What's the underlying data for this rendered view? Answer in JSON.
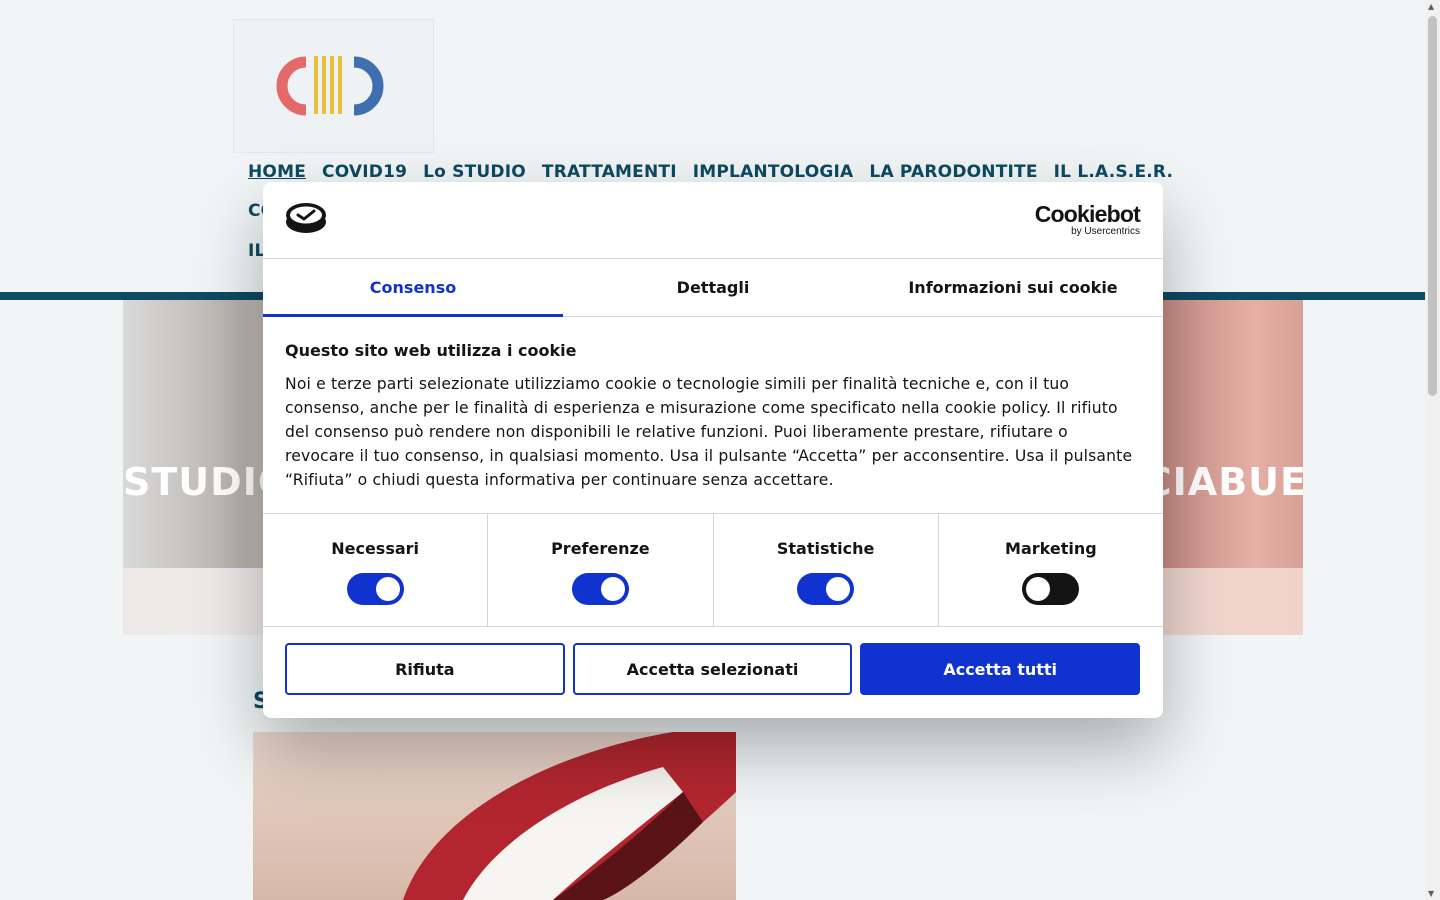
{
  "page": {
    "nav": {
      "row1": [
        "HOME",
        "COVID19",
        "Lo STUDIO",
        "TRATTAMENTI",
        "IMPLANTOLOGIA",
        "LA PARODONTITE",
        "IL L.A.S.E.R."
      ],
      "row2_partial": "CO",
      "row3_partial": "IL"
    },
    "hero": {
      "title_left": "STUDIO",
      "title_right": "CIABUE"
    },
    "section_partial": "S"
  },
  "cookie": {
    "brand_name": "Cookiebot",
    "brand_sub": "by Usercentrics",
    "tabs": [
      "Consenso",
      "Dettagli",
      "Informazioni sui cookie"
    ],
    "active_tab": "Consenso",
    "heading": "Questo sito web utilizza i cookie",
    "body": "Noi e terze parti selezionate utilizziamo cookie o tecnologie simili per finalità tecniche e, con il tuo consenso, anche per le finalità di esperienza e misurazione come specificato nella cookie policy. Il rifiuto del consenso può rendere non disponibili le relative funzioni. Puoi liberamente prestare, rifiutare o revocare il tuo consenso, in qualsiasi momento. Usa il pulsante “Accetta” per acconsentire. Usa il pulsante “Rifiuta” o chiudi questa informativa per continuare senza accettare.",
    "categories": [
      {
        "label": "Necessari",
        "enabled": true
      },
      {
        "label": "Preferenze",
        "enabled": true
      },
      {
        "label": "Statistiche",
        "enabled": true
      },
      {
        "label": "Marketing",
        "enabled": false
      }
    ],
    "buttons": {
      "reject": "Rifiuta",
      "accept_selected": "Accetta selezionati",
      "accept_all": "Accetta tutti"
    }
  },
  "colors": {
    "accent": "#1032cf",
    "nav": "#0d4a63",
    "background": "#f1f5f6"
  }
}
